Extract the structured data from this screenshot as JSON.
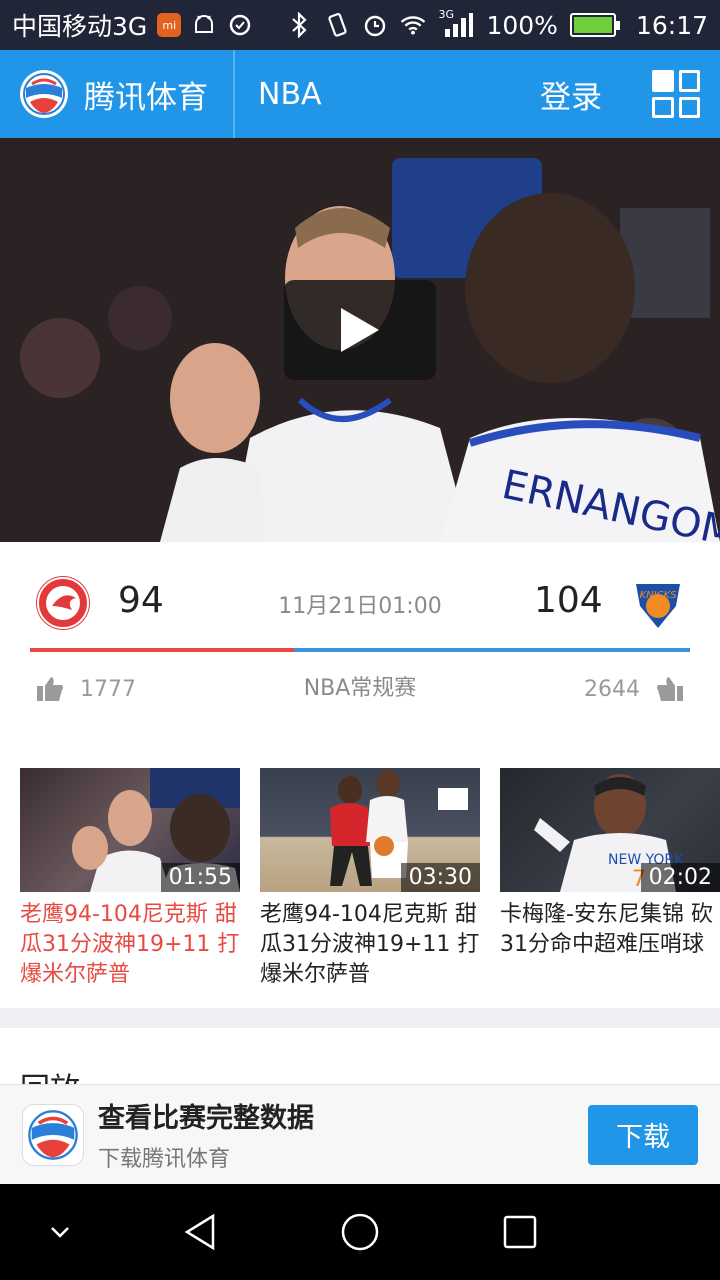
{
  "status_bar": {
    "carrier": "中国移动3G",
    "battery_percent": "100%",
    "time": "16:17",
    "network": "3G",
    "icons": [
      "mi-icon",
      "android-icon",
      "sync-icon",
      "bluetooth-icon",
      "vibrate-icon",
      "alarm-icon",
      "wifi-icon",
      "signal-icon",
      "battery-icon"
    ],
    "battery_level": 1.0
  },
  "header": {
    "brand_name": "腾讯体育",
    "section": "NBA",
    "login_label": "登录",
    "colors": {
      "header_bg": "#2196e8",
      "status_bg": "#202638"
    }
  },
  "video": {
    "jersey_text": "ERNANGOME",
    "play_icon": "play-icon"
  },
  "match": {
    "home_score": "94",
    "away_score": "104",
    "time": "11月21日01:00",
    "league": "NBA常规赛",
    "home_likes": "1777",
    "away_likes": "2644",
    "home_team_logo": "hawks-logo",
    "away_team_logo": "knicks-logo",
    "home_bar_color": "#e84a42",
    "away_bar_color": "#3a92e0",
    "home_share": 0.4,
    "away_share": 0.6
  },
  "related_videos": [
    {
      "duration": "01:55",
      "title": "老鹰94-104尼克斯 甜瓜31分波神19+11 打爆米尔萨普",
      "active": true
    },
    {
      "duration": "03:30",
      "title": "老鹰94-104尼克斯 甜瓜31分波神19+11 打爆米尔萨普",
      "active": false
    },
    {
      "duration": "02:02",
      "title": "卡梅隆-安东尼集锦 砍31分命中超难压哨球",
      "active": false
    }
  ],
  "replay": {
    "title": "回放"
  },
  "banner": {
    "title": "查看比赛完整数据",
    "subtitle": "下载腾讯体育",
    "button_label": "下载"
  },
  "nav_bar": {
    "icons": [
      "chevron-down-icon",
      "back-icon",
      "home-icon",
      "recent-apps-icon"
    ]
  }
}
